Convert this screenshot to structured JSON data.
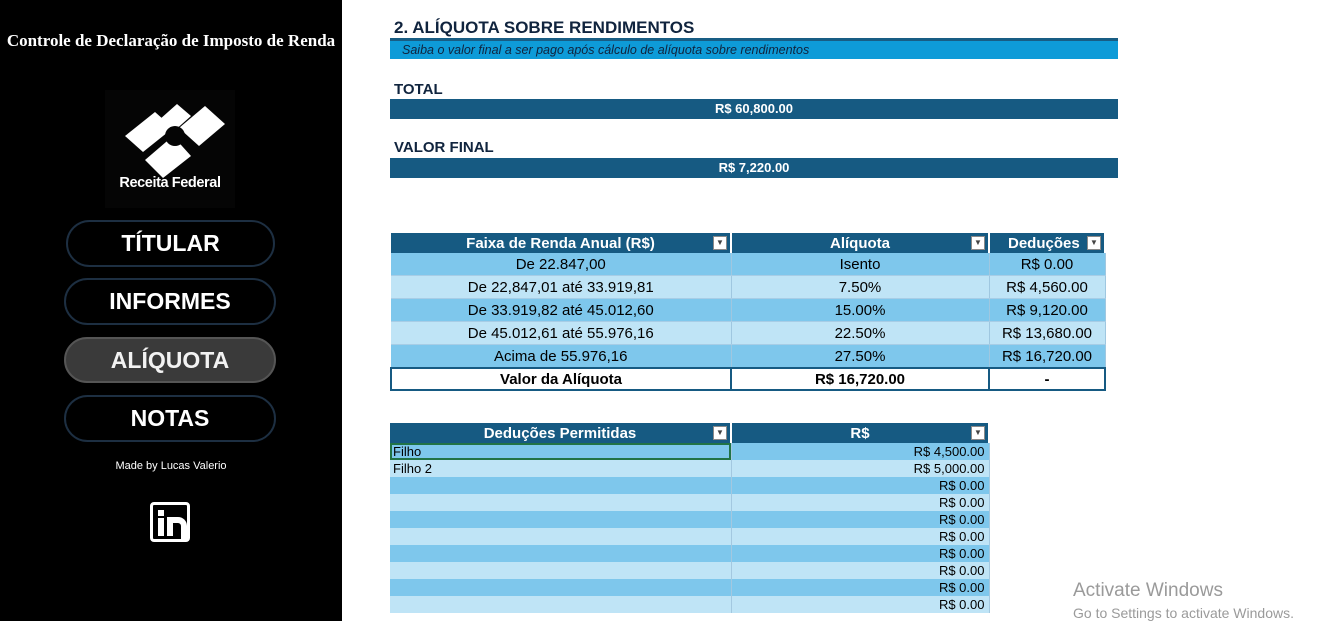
{
  "sidebar": {
    "app_title": "Controle de Declaração de Imposto de Renda",
    "logo_text": "Receita Federal",
    "nav": [
      {
        "label": "TÍTULAR",
        "active": false
      },
      {
        "label": "INFORMES",
        "active": false
      },
      {
        "label": "ALÍQUOTA",
        "active": true
      },
      {
        "label": "NOTAS",
        "active": false
      }
    ],
    "made_by": "Made by Lucas Valerio",
    "social_icon": "linkedin-icon"
  },
  "main": {
    "section_title": "2. ALÍQUOTA SOBRE RENDIMENTOS",
    "subtitle": "Saiba o valor final a ser pago após cálculo de alíquota sobre rendimentos",
    "total_label": "TOTAL",
    "total_value": "R$ 60,800.00",
    "final_label": "VALOR FINAL",
    "final_value": "R$ 7,220.00"
  },
  "brackets": {
    "headers": [
      "Faixa de Renda Anual (R$)",
      "Alíquota",
      "Deduções"
    ],
    "rows": [
      [
        "De 22.847,00",
        "Isento",
        "R$ 0.00"
      ],
      [
        "De 22,847,01 até 33.919,81",
        "7.50%",
        "R$ 4,560.00"
      ],
      [
        "De 33.919,82 até 45.012,60",
        "15.00%",
        "R$ 9,120.00"
      ],
      [
        "De 45.012,61 até 55.976,16",
        "22.50%",
        "R$ 13,680.00"
      ],
      [
        "Acima de 55.976,16",
        "27.50%",
        "R$ 16,720.00"
      ]
    ],
    "total_row": [
      "Valor da Alíquota",
      "R$ 16,720.00",
      "-"
    ]
  },
  "deductions": {
    "headers": [
      "Deduções Permitidas",
      "R$"
    ],
    "rows": [
      [
        "Filho",
        "R$ 4,500.00"
      ],
      [
        "Filho 2",
        "R$ 5,000.00"
      ],
      [
        "",
        "R$ 0.00"
      ],
      [
        "",
        "R$ 0.00"
      ],
      [
        "",
        "R$ 0.00"
      ],
      [
        "",
        "R$ 0.00"
      ],
      [
        "",
        "R$ 0.00"
      ],
      [
        "",
        "R$ 0.00"
      ],
      [
        "",
        "R$ 0.00"
      ],
      [
        "",
        "R$ 0.00"
      ]
    ]
  },
  "watermark": {
    "title": "Activate Windows",
    "subtitle": "Go to Settings to activate Windows."
  },
  "colors": {
    "header_blue": "#165a82",
    "accent_blue": "#0e9bd8",
    "row_dark": "#7ec7ec",
    "row_light": "#bfe4f6"
  }
}
